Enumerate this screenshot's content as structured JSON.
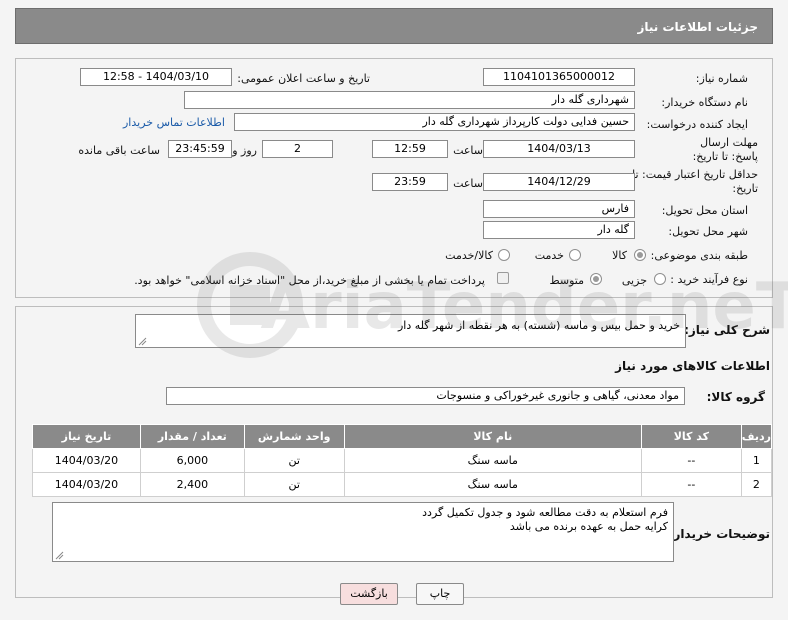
{
  "header": {
    "title": "جزئیات اطلاعات نیاز"
  },
  "form": {
    "need_number_label": "شماره نیاز:",
    "need_number": "1104101365000012",
    "announce_label": "تاریخ و ساعت اعلان عمومی:",
    "announce_value": "1404/03/10 - 12:58",
    "buyer_org_label": "نام دستگاه خریدار:",
    "buyer_org": "شهرداری گله دار",
    "creator_label": "ایجاد کننده درخواست:",
    "creator": "حسین فدایی دولت کارپرداز شهرداری گله دار",
    "contact_link": "اطلاعات تماس خریدار",
    "deadline_label": "مهلت ارسال پاسخ: تا تاریخ:",
    "deadline_date": "1404/03/13",
    "time_label": "ساعت",
    "deadline_time": "12:59",
    "days_value": "2",
    "days_label": "روز و",
    "remaining_time": "23:45:59",
    "remaining_label": "ساعت باقی مانده",
    "validity_label": "حداقل تاریخ اعتبار قیمت: تا تاریخ:",
    "validity_date": "1404/12/29",
    "validity_time": "23:59",
    "province_label": "استان محل تحویل:",
    "province": "فارس",
    "city_label": "شهر محل تحویل:",
    "city": "گله دار",
    "category_label": "طبقه بندی موضوعی:",
    "category_options": [
      "کالا",
      "خدمت",
      "کالا/خدمت"
    ],
    "process_label": "نوع فرآیند خرید :",
    "process_options": [
      "جزیی",
      "متوسط"
    ],
    "payment_note": "پرداخت تمام یا بخشی از مبلغ خرید،از محل \"اسناد خزانه اسلامی\" خواهد بود."
  },
  "description": {
    "label": "شرح کلی نیاز:",
    "text": "خرید و حمل بیس و ماسه (شسته) به هر نقطه از شهر گله دار"
  },
  "goods": {
    "section_title": "اطلاعات کالاهای مورد نیاز",
    "group_label": "گروه کالا:",
    "group_value": "مواد معدنی، گیاهی و جانوری غیرخوراکی و منسوجات",
    "columns": [
      "ردیف",
      "کد کالا",
      "نام کالا",
      "واحد شمارش",
      "تعداد / مقدار",
      "تاریخ نیاز"
    ],
    "rows": [
      [
        "1",
        "--",
        "ماسه سنگ",
        "تن",
        "6,000",
        "1404/03/20"
      ],
      [
        "2",
        "--",
        "ماسه سنگ",
        "تن",
        "2,400",
        "1404/03/20"
      ]
    ]
  },
  "buyer_notes": {
    "label": "توضیحات خریدار:",
    "line1": "فرم استعلام به دقت مطالعه شود و جدول تکمیل گردد",
    "line2": "کرایه حمل به عهده برنده می باشد"
  },
  "buttons": {
    "print": "چاپ",
    "back": "بازگشت"
  },
  "watermark": {
    "text": "AriaTender.neT"
  }
}
